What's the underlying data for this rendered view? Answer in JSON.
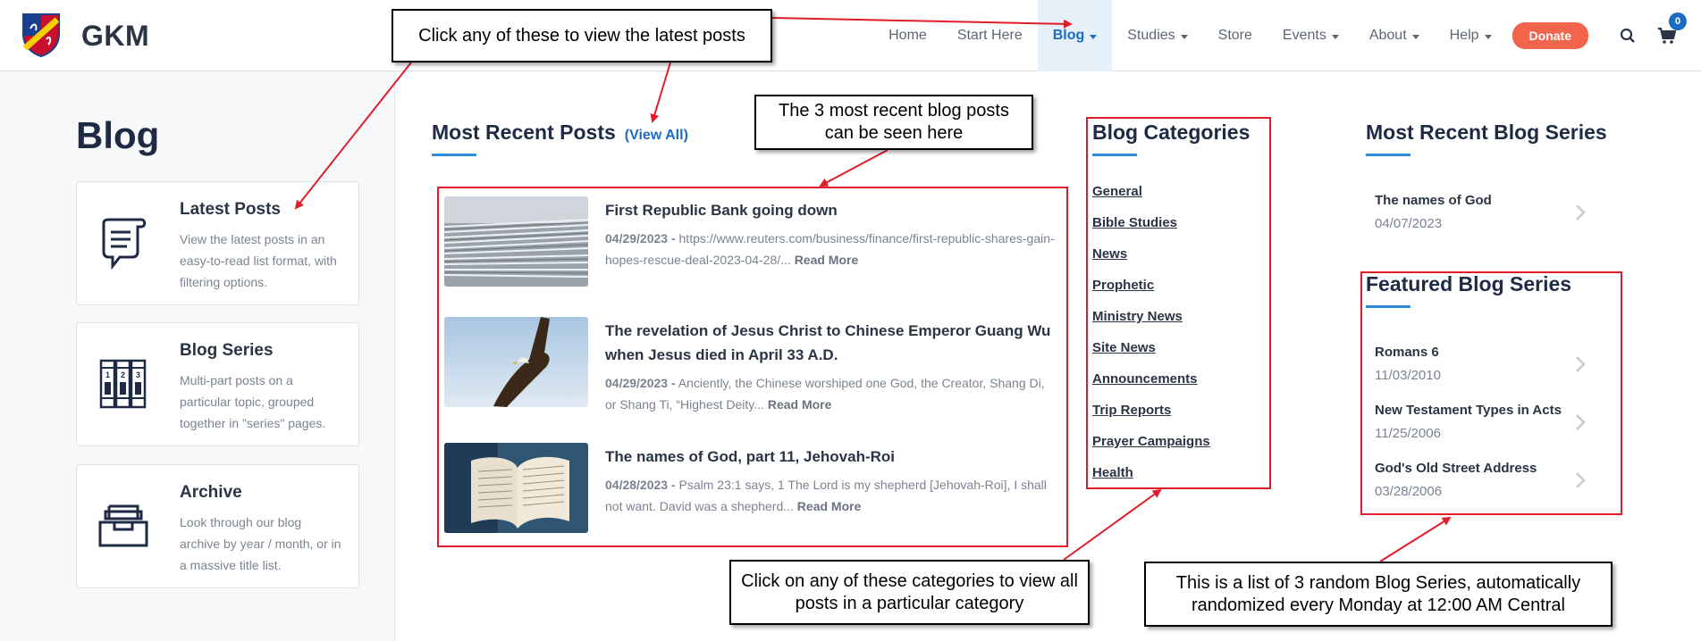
{
  "header": {
    "brand": "GKM",
    "nav": [
      {
        "label": "Home",
        "dropdown": false,
        "active": false
      },
      {
        "label": "Start Here",
        "dropdown": false,
        "active": false
      },
      {
        "label": "Blog",
        "dropdown": true,
        "active": true
      },
      {
        "label": "Studies",
        "dropdown": true,
        "active": false
      },
      {
        "label": "Store",
        "dropdown": false,
        "active": false
      },
      {
        "label": "Events",
        "dropdown": true,
        "active": false
      },
      {
        "label": "About",
        "dropdown": true,
        "active": false
      },
      {
        "label": "Help",
        "dropdown": true,
        "active": false
      }
    ],
    "donate": "Donate",
    "cart_count": "0",
    "icons": [
      "search-icon",
      "cart-icon"
    ],
    "accent": "#1c6cc4",
    "donate_color": "#f2644c"
  },
  "sidebar": {
    "title": "Blog",
    "cards": [
      {
        "title": "Latest Posts",
        "desc": "View the latest posts in an easy-to-read list format, with filtering options.",
        "icon": "scroll-icon"
      },
      {
        "title": "Blog Series",
        "desc": "Multi-part posts on a particular topic, grouped together in \"series\" pages.",
        "icon": "books-icon"
      },
      {
        "title": "Archive",
        "desc": "Look through our blog archive by year / month, or in a massive title list.",
        "icon": "archive-box-icon"
      }
    ]
  },
  "recent_posts": {
    "heading": "Most Recent Posts",
    "view_all": "(View All)",
    "posts": [
      {
        "title": "First Republic Bank going down",
        "date": "04/29/2023 -",
        "excerpt": "https://www.reuters.com/business/finance/first-republic-shares-gain-hopes-rescue-deal-2023-04-28/...",
        "read_more": "Read More",
        "thumb": "newspaper-image"
      },
      {
        "title": "The revelation of Jesus Christ to Chinese Emperor Guang Wu when Jesus died in April 33 A.D.",
        "date": "04/29/2023 -",
        "excerpt": "Anciently, the Chinese worshiped one God, the Creator, Shang Di, or Shang Ti, “Highest Deity...",
        "read_more": "Read More",
        "thumb": "eagle-image"
      },
      {
        "title": "The names of God, part 11, Jehovah-Roi",
        "date": "04/28/2023 -",
        "excerpt": "Psalm 23:1 says, 1 The Lord is my shepherd [Jehovah-Roi], I shall not want. David was a shepherd...",
        "read_more": "Read More",
        "thumb": "bible-image"
      }
    ]
  },
  "categories": {
    "heading": "Blog Categories",
    "items": [
      "General",
      "Bible Studies",
      "News",
      "Prophetic",
      "Ministry News",
      "Site News",
      "Announcements",
      "Trip Reports",
      "Prayer Campaigns",
      "Health"
    ]
  },
  "recent_series": {
    "heading": "Most Recent Blog Series",
    "items": [
      {
        "title": "The names of God",
        "date": "04/07/2023"
      }
    ]
  },
  "featured_series": {
    "heading": "Featured Blog Series",
    "items": [
      {
        "title": "Romans 6",
        "date": "11/03/2010"
      },
      {
        "title": "New Testament Types in Acts",
        "date": "11/25/2006"
      },
      {
        "title": "God's Old Street Address",
        "date": "03/28/2006"
      }
    ]
  },
  "annotations": {
    "latest_posts_note": "Click any of these to view the latest posts",
    "recent_posts_note": "The 3 most recent blog posts can be seen here",
    "categories_note": "Click on any of these categories to view all posts in a particular category",
    "series_note": "This is a list of 3 random Blog Series, automatically randomized every Monday at 12:00 AM Central",
    "annotation_color": "#e11d2a"
  }
}
